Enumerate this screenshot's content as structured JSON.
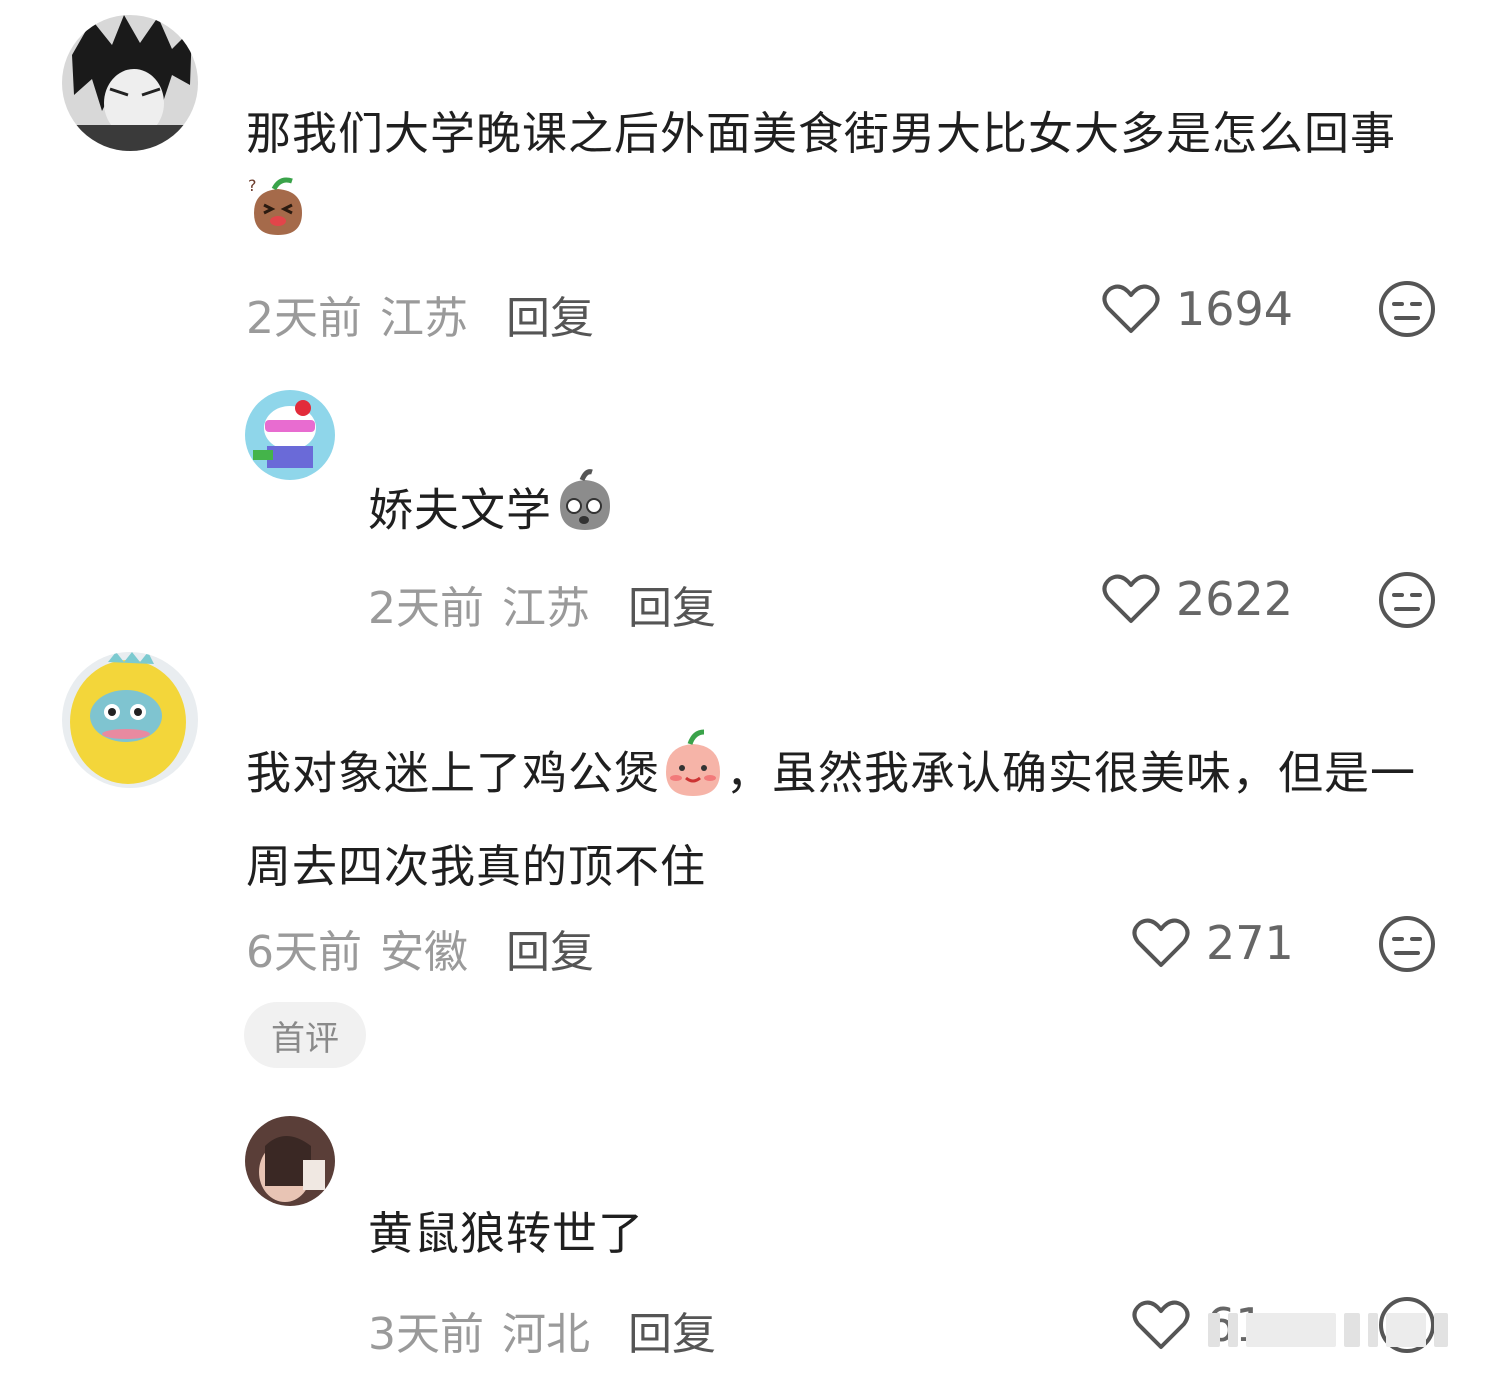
{
  "comments": [
    {
      "text": "那我们大学晚课之后外面美食街男大比女大多是怎么回事",
      "emoji": "sack-wince-emoji",
      "time": "2天前",
      "location": "江苏",
      "reply_label": "回复",
      "likes": "1694"
    },
    {
      "text": "娇夫文学",
      "emoji": "sack-shocked-emoji",
      "time": "2天前",
      "location": "江苏",
      "reply_label": "回复",
      "likes": "2622"
    },
    {
      "text_part1": "我对象迷上了鸡公煲",
      "text_part2": "，虽然我承认确实很美味，但是一周去四次我真的顶不住",
      "emoji": "peach-blush-emoji",
      "time": "6天前",
      "location": "安徽",
      "reply_label": "回复",
      "likes": "271",
      "badge": "首评"
    },
    {
      "text": "黄鼠狼转世了",
      "time": "3天前",
      "location": "河北",
      "reply_label": "回复",
      "likes": "61"
    }
  ]
}
